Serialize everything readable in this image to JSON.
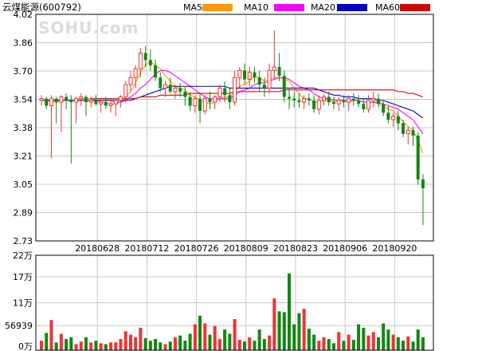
{
  "header": {
    "title": "云煤能源(600792)",
    "watermark": "SOHU.com"
  },
  "legend": [
    {
      "label": "MA5",
      "color": "#ff9900"
    },
    {
      "label": "MA10",
      "color": "#ff00ff"
    },
    {
      "label": "MA20",
      "color": "#0000cc"
    },
    {
      "label": "MA60",
      "color": "#dd0000"
    }
  ],
  "colors": {
    "up": "#ee3333",
    "down": "#118811",
    "grid": "#c8c8c8",
    "axis": "#000000",
    "background": "#ffffff"
  },
  "chart_data": [
    {
      "type": "candlestick",
      "title": "",
      "xlabel": "",
      "ylabel": "",
      "ylim": [
        2.73,
        4.02
      ],
      "yticks": [
        "4.02",
        "3.86",
        "3.70",
        "3.54",
        "3.38",
        "3.21",
        "3.05",
        "2.89",
        "2.73"
      ],
      "xticks": [
        {
          "label": "20180628",
          "index": 10
        },
        {
          "label": "20180712",
          "index": 20
        },
        {
          "label": "20180726",
          "index": 30
        },
        {
          "label": "20180809",
          "index": 40
        },
        {
          "label": "20180823",
          "index": 50
        },
        {
          "label": "20180906",
          "index": 60
        },
        {
          "label": "20180920",
          "index": 70
        }
      ],
      "ohlc": [
        [
          3.53,
          3.56,
          3.5,
          3.54
        ],
        [
          3.54,
          3.55,
          3.48,
          3.5
        ],
        [
          3.5,
          3.56,
          3.2,
          3.54
        ],
        [
          3.54,
          3.55,
          3.4,
          3.52
        ],
        [
          3.52,
          3.56,
          3.35,
          3.55
        ],
        [
          3.55,
          3.57,
          3.48,
          3.53
        ],
        [
          3.53,
          3.56,
          3.17,
          3.52
        ],
        [
          3.52,
          3.55,
          3.4,
          3.54
        ],
        [
          3.54,
          3.57,
          3.5,
          3.55
        ],
        [
          3.55,
          3.56,
          3.44,
          3.52
        ],
        [
          3.52,
          3.55,
          3.49,
          3.53
        ],
        [
          3.53,
          3.56,
          3.5,
          3.51
        ],
        [
          3.51,
          3.54,
          3.46,
          3.52
        ],
        [
          3.52,
          3.55,
          3.48,
          3.5
        ],
        [
          3.5,
          3.53,
          3.46,
          3.51
        ],
        [
          3.51,
          3.54,
          3.44,
          3.53
        ],
        [
          3.53,
          3.56,
          3.49,
          3.55
        ],
        [
          3.55,
          3.64,
          3.52,
          3.62
        ],
        [
          3.62,
          3.7,
          3.58,
          3.66
        ],
        [
          3.66,
          3.73,
          3.6,
          3.71
        ],
        [
          3.71,
          3.83,
          3.66,
          3.8
        ],
        [
          3.8,
          3.84,
          3.72,
          3.76
        ],
        [
          3.76,
          3.82,
          3.7,
          3.73
        ],
        [
          3.73,
          3.76,
          3.64,
          3.66
        ],
        [
          3.66,
          3.69,
          3.58,
          3.6
        ],
        [
          3.6,
          3.64,
          3.55,
          3.62
        ],
        [
          3.62,
          3.66,
          3.57,
          3.58
        ],
        [
          3.58,
          3.62,
          3.54,
          3.6
        ],
        [
          3.6,
          3.63,
          3.55,
          3.58
        ],
        [
          3.58,
          3.61,
          3.5,
          3.55
        ],
        [
          3.55,
          3.58,
          3.47,
          3.5
        ],
        [
          3.5,
          3.56,
          3.46,
          3.54
        ],
        [
          3.54,
          3.57,
          3.4,
          3.47
        ],
        [
          3.47,
          3.56,
          3.45,
          3.54
        ],
        [
          3.54,
          3.58,
          3.48,
          3.52
        ],
        [
          3.52,
          3.56,
          3.48,
          3.55
        ],
        [
          3.55,
          3.62,
          3.52,
          3.6
        ],
        [
          3.6,
          3.64,
          3.52,
          3.56
        ],
        [
          3.56,
          3.6,
          3.48,
          3.52
        ],
        [
          3.52,
          3.7,
          3.5,
          3.66
        ],
        [
          3.66,
          3.72,
          3.6,
          3.7
        ],
        [
          3.7,
          3.74,
          3.62,
          3.65
        ],
        [
          3.65,
          3.72,
          3.61,
          3.69
        ],
        [
          3.69,
          3.72,
          3.63,
          3.66
        ],
        [
          3.66,
          3.7,
          3.58,
          3.62
        ],
        [
          3.62,
          3.66,
          3.55,
          3.6
        ],
        [
          3.6,
          3.74,
          3.57,
          3.7
        ],
        [
          3.7,
          3.93,
          3.65,
          3.72
        ],
        [
          3.72,
          3.8,
          3.64,
          3.67
        ],
        [
          3.67,
          3.7,
          3.52,
          3.55
        ],
        [
          3.55,
          3.6,
          3.48,
          3.54
        ],
        [
          3.54,
          3.58,
          3.49,
          3.53
        ],
        [
          3.53,
          3.57,
          3.49,
          3.52
        ],
        [
          3.52,
          3.56,
          3.48,
          3.54
        ],
        [
          3.54,
          3.57,
          3.5,
          3.53
        ],
        [
          3.53,
          3.56,
          3.46,
          3.48
        ],
        [
          3.48,
          3.56,
          3.45,
          3.53
        ],
        [
          3.53,
          3.57,
          3.5,
          3.55
        ],
        [
          3.55,
          3.58,
          3.5,
          3.52
        ],
        [
          3.52,
          3.55,
          3.48,
          3.51
        ],
        [
          3.51,
          3.55,
          3.47,
          3.53
        ],
        [
          3.53,
          3.56,
          3.49,
          3.52
        ],
        [
          3.52,
          3.56,
          3.47,
          3.54
        ],
        [
          3.54,
          3.57,
          3.5,
          3.53
        ],
        [
          3.53,
          3.56,
          3.49,
          3.51
        ],
        [
          3.51,
          3.54,
          3.46,
          3.48
        ],
        [
          3.48,
          3.56,
          3.46,
          3.53
        ],
        [
          3.53,
          3.58,
          3.49,
          3.54
        ],
        [
          3.54,
          3.57,
          3.49,
          3.51
        ],
        [
          3.51,
          3.53,
          3.44,
          3.46
        ],
        [
          3.46,
          3.5,
          3.4,
          3.42
        ],
        [
          3.42,
          3.46,
          3.38,
          3.44
        ],
        [
          3.44,
          3.47,
          3.36,
          3.4
        ],
        [
          3.4,
          3.42,
          3.32,
          3.34
        ],
        [
          3.34,
          3.38,
          3.28,
          3.36
        ],
        [
          3.36,
          3.38,
          3.27,
          3.33
        ],
        [
          3.33,
          3.35,
          3.05,
          3.08
        ],
        [
          3.08,
          3.11,
          2.82,
          3.03
        ]
      ],
      "ma": {
        "MA5": [
          3.53,
          3.53,
          3.52,
          3.52,
          3.53,
          3.53,
          3.53,
          3.53,
          3.54,
          3.54,
          3.54,
          3.53,
          3.52,
          3.52,
          3.51,
          3.51,
          3.52,
          3.55,
          3.58,
          3.63,
          3.69,
          3.73,
          3.75,
          3.73,
          3.71,
          3.67,
          3.64,
          3.61,
          3.6,
          3.59,
          3.56,
          3.55,
          3.53,
          3.52,
          3.51,
          3.52,
          3.54,
          3.55,
          3.55,
          3.58,
          3.61,
          3.62,
          3.64,
          3.67,
          3.66,
          3.64,
          3.65,
          3.66,
          3.66,
          3.65,
          3.64,
          3.6,
          3.57,
          3.54,
          3.54,
          3.52,
          3.52,
          3.53,
          3.53,
          3.52,
          3.53,
          3.53,
          3.52,
          3.53,
          3.53,
          3.52,
          3.52,
          3.52,
          3.51,
          3.5,
          3.48,
          3.47,
          3.44,
          3.41,
          3.38,
          3.36,
          3.3,
          3.23
        ],
        "MA10": [
          3.53,
          3.53,
          3.53,
          3.53,
          3.53,
          3.53,
          3.53,
          3.53,
          3.53,
          3.53,
          3.53,
          3.53,
          3.53,
          3.53,
          3.53,
          3.52,
          3.52,
          3.53,
          3.55,
          3.57,
          3.6,
          3.62,
          3.65,
          3.68,
          3.7,
          3.7,
          3.69,
          3.67,
          3.65,
          3.63,
          3.61,
          3.59,
          3.57,
          3.55,
          3.54,
          3.54,
          3.54,
          3.54,
          3.54,
          3.56,
          3.58,
          3.59,
          3.6,
          3.62,
          3.63,
          3.63,
          3.64,
          3.65,
          3.66,
          3.66,
          3.65,
          3.63,
          3.61,
          3.6,
          3.59,
          3.57,
          3.55,
          3.54,
          3.54,
          3.53,
          3.53,
          3.53,
          3.53,
          3.53,
          3.53,
          3.52,
          3.52,
          3.52,
          3.52,
          3.51,
          3.5,
          3.49,
          3.48,
          3.46,
          3.44,
          3.42,
          3.38,
          3.34
        ],
        "MA20": [
          3.53,
          3.53,
          3.53,
          3.53,
          3.53,
          3.53,
          3.53,
          3.53,
          3.53,
          3.53,
          3.53,
          3.53,
          3.53,
          3.53,
          3.53,
          3.53,
          3.53,
          3.53,
          3.53,
          3.54,
          3.55,
          3.56,
          3.57,
          3.58,
          3.59,
          3.6,
          3.61,
          3.61,
          3.61,
          3.61,
          3.61,
          3.61,
          3.61,
          3.61,
          3.61,
          3.61,
          3.61,
          3.61,
          3.6,
          3.6,
          3.6,
          3.6,
          3.6,
          3.6,
          3.6,
          3.6,
          3.6,
          3.6,
          3.6,
          3.6,
          3.6,
          3.6,
          3.6,
          3.6,
          3.6,
          3.6,
          3.59,
          3.58,
          3.57,
          3.56,
          3.56,
          3.55,
          3.55,
          3.55,
          3.54,
          3.54,
          3.54,
          3.54,
          3.53,
          3.53,
          3.52,
          3.51,
          3.5,
          3.49,
          3.48,
          3.47,
          3.45,
          3.43
        ],
        "MA60": [
          null,
          null,
          null,
          null,
          null,
          null,
          null,
          null,
          null,
          null,
          3.54,
          3.54,
          3.54,
          3.54,
          3.54,
          3.54,
          3.54,
          3.54,
          3.54,
          3.54,
          3.55,
          3.55,
          3.55,
          3.55,
          3.56,
          3.56,
          3.56,
          3.56,
          3.56,
          3.56,
          3.57,
          3.57,
          3.57,
          3.57,
          3.57,
          3.57,
          3.57,
          3.57,
          3.57,
          3.58,
          3.58,
          3.58,
          3.58,
          3.58,
          3.58,
          3.58,
          3.58,
          3.58,
          3.58,
          3.59,
          3.59,
          3.59,
          3.59,
          3.59,
          3.59,
          3.59,
          3.59,
          3.59,
          3.59,
          3.59,
          3.59,
          3.59,
          3.59,
          3.59,
          3.59,
          3.59,
          3.59,
          3.59,
          3.59,
          3.59,
          3.59,
          3.59,
          3.58,
          3.58,
          3.57,
          3.57,
          3.56,
          3.55
        ]
      }
    },
    {
      "type": "bar",
      "title": "",
      "xlabel": "",
      "ylabel": "",
      "ylim": [
        0,
        220000
      ],
      "yticks": [
        {
          "label": "22万",
          "value": 220000
        },
        {
          "label": "17万",
          "value": 170000
        },
        {
          "label": "11万",
          "value": 110000
        },
        {
          "label": "56939",
          "value": 56939
        },
        {
          "label": "0万",
          "value": 0
        }
      ],
      "values": [
        22000,
        40000,
        70000,
        18000,
        38000,
        26000,
        30000,
        14000,
        20000,
        30000,
        18000,
        22000,
        16000,
        14000,
        18000,
        18000,
        26000,
        44000,
        36000,
        30000,
        52000,
        28000,
        22000,
        26000,
        18000,
        14000,
        20000,
        30000,
        34000,
        22000,
        38000,
        60000,
        80000,
        62000,
        36000,
        56000,
        26000,
        48000,
        38000,
        72000,
        24000,
        20000,
        30000,
        22000,
        48000,
        26000,
        34000,
        120000,
        90000,
        88000,
        178000,
        60000,
        86000,
        96000,
        50000,
        36000,
        22000,
        30000,
        26000,
        16000,
        42000,
        22000,
        36000,
        24000,
        60000,
        52000,
        34000,
        42000,
        30000,
        62000,
        48000,
        36000,
        30000,
        22000,
        32000,
        20000,
        48000,
        30000
      ]
    }
  ]
}
